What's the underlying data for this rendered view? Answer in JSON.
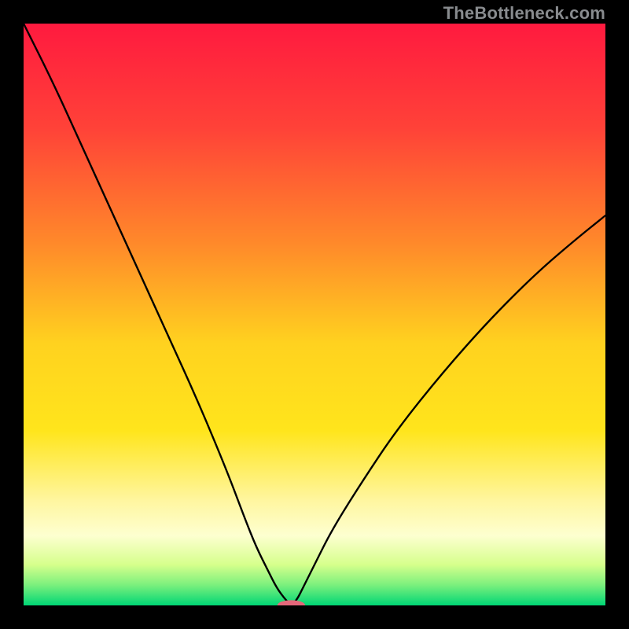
{
  "watermark": "TheBottleneck.com",
  "chart_data": {
    "type": "line",
    "title": "",
    "xlabel": "",
    "ylabel": "",
    "xlim": [
      0,
      100
    ],
    "ylim": [
      0,
      100
    ],
    "gradient_stops": [
      {
        "offset": 0.0,
        "color": "#ff1a3f"
      },
      {
        "offset": 0.18,
        "color": "#ff4238"
      },
      {
        "offset": 0.38,
        "color": "#ff8a2a"
      },
      {
        "offset": 0.55,
        "color": "#ffd21f"
      },
      {
        "offset": 0.7,
        "color": "#ffe51c"
      },
      {
        "offset": 0.82,
        "color": "#fff6a0"
      },
      {
        "offset": 0.88,
        "color": "#fdffd0"
      },
      {
        "offset": 0.93,
        "color": "#d6ff8c"
      },
      {
        "offset": 0.965,
        "color": "#7bf07d"
      },
      {
        "offset": 1.0,
        "color": "#00d675"
      }
    ],
    "series": [
      {
        "name": "bottleneck-curve",
        "x": [
          0,
          5,
          10,
          15,
          20,
          25,
          30,
          35,
          38,
          40,
          42,
          43.5,
          45,
          46,
          47,
          48,
          50,
          53,
          58,
          64,
          72,
          80,
          88,
          95,
          100
        ],
        "y": [
          100,
          90,
          79,
          68,
          57,
          46,
          35,
          23,
          15,
          10,
          6,
          3,
          1,
          0,
          1,
          3,
          7,
          13,
          21,
          30,
          40,
          49,
          57,
          63,
          67
        ]
      }
    ],
    "marker": {
      "x": 46,
      "y": 0,
      "rx": 2.4,
      "ry": 0.9,
      "color": "#e4677a"
    },
    "optimal_x": 46
  }
}
